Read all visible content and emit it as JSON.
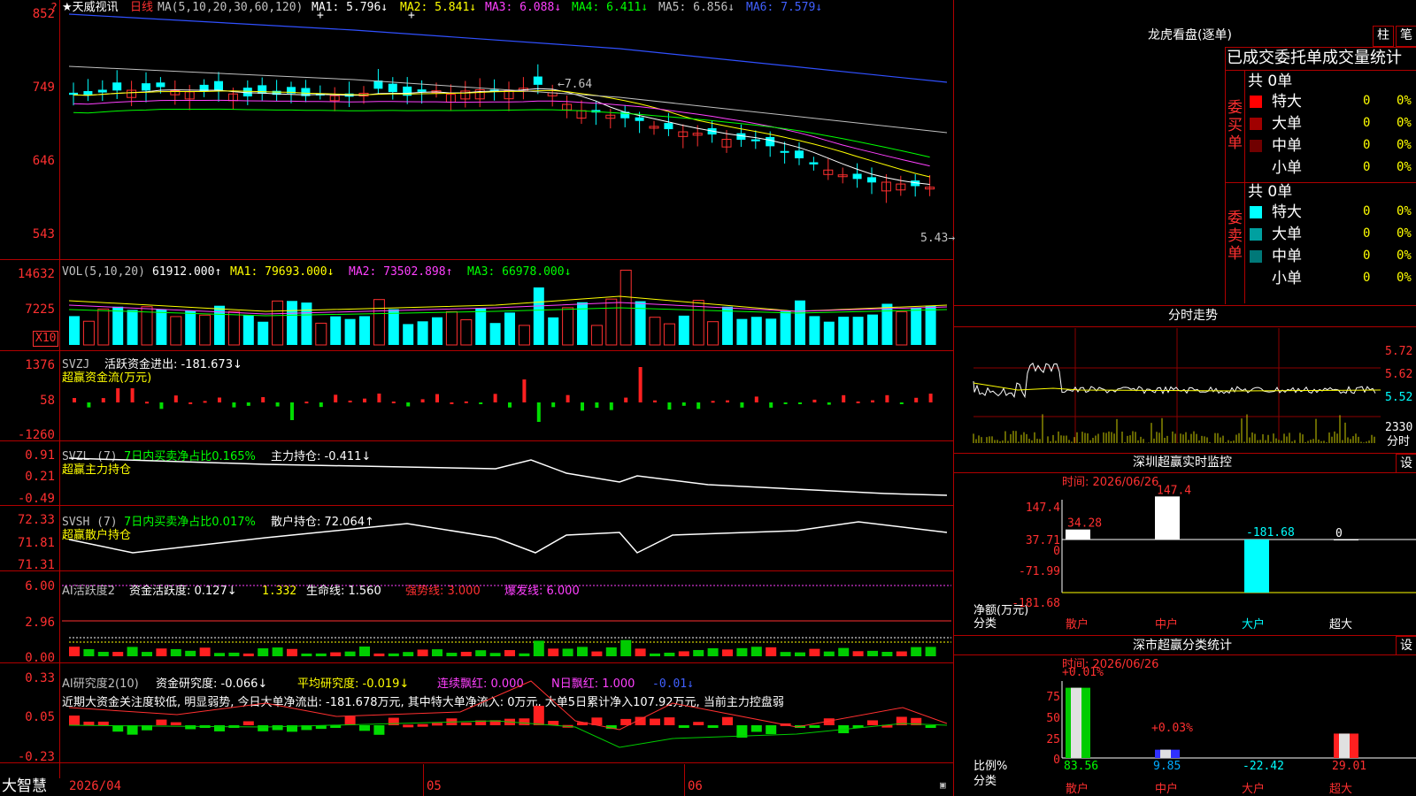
{
  "axes": {
    "main": [
      "852",
      "749",
      "646",
      "543"
    ],
    "vol": [
      "14632",
      "7225"
    ],
    "vol_unit": "X10",
    "svzj": [
      "1376",
      "58",
      "-1260"
    ],
    "svzl": [
      "0.91",
      "0.21",
      "-0.49"
    ],
    "svsh": [
      "72.33",
      "71.81",
      "71.31"
    ],
    "ai1": [
      "6.00",
      "2.96",
      "0.00"
    ],
    "ai2": [
      "0.33",
      "0.05",
      "-0.23"
    ]
  },
  "main": {
    "title": "★天威视讯",
    "period": "日线",
    "ma_prefix": "MA(5,10,20,30,60,120)",
    "ma1": "MA1: 5.796↓",
    "ma2": "MA2: 5.841↓",
    "ma3": "MA3: 6.088↓",
    "ma4": "MA4: 6.411↓",
    "ma5": "MA5: 6.856↓",
    "ma6": "MA6: 7.579↓",
    "high_label": "←7.64",
    "low_label": "5.43→"
  },
  "vol": {
    "prefix": "VOL(5,10,20)",
    "value": "61912.000↑",
    "ma1": "MA1: 79693.000↓",
    "ma2": "MA2: 73502.898↑",
    "ma3": "MA3: 66978.000↓"
  },
  "svzj": {
    "prefix": "SVZJ",
    "label": "活跃资金进出: -181.673↓",
    "sub": "超赢资金流(万元)"
  },
  "svzl": {
    "prefix": "SVZL (7)",
    "ratio": "7日内买卖净占比0.165%",
    "hold": "主力持仓: -0.411↓",
    "sub": "超赢主力持仓"
  },
  "svsh": {
    "prefix": "SVSH (7)",
    "ratio": "7日内买卖净占比0.017%",
    "hold": "散户持仓: 72.064↑",
    "sub": "超赢散户持仓"
  },
  "ai1": {
    "prefix": "AI活跃度2",
    "a": "资金活跃度: 0.127↓",
    "b": "1.332",
    "c": "生命线: 1.560",
    "d": "强势线: 3.000",
    "e": "爆发线: 6.000"
  },
  "ai2": {
    "prefix": "AI研究度2(10)",
    "a": "资金研究度: -0.066↓",
    "b": "平均研究度: -0.019↓",
    "c": "连续飘红: 0.000",
    "d": "N日飘红: 1.000",
    "e": "-0.01↓",
    "comment": "近期大资金关注度较低, 明显弱势, 今日大单净流出: -181.678万元, 其中特大单净流入: 0万元, 大单5日累计净入107.92万元, 当前主力控盘弱"
  },
  "bottom": {
    "logo": "大智慧",
    "date1": "2026/04",
    "date2": "05",
    "date3": "06"
  },
  "right": {
    "title": "龙虎看盘(逐单)",
    "btn_bar": "柱",
    "btn_pen": "笔",
    "tabs": "已成交委托单成交量统计",
    "buy_side": "委买单",
    "sell_side": "委卖单",
    "buy_total": "共 0单",
    "sell_total": "共 0单",
    "buy_rows": [
      {
        "label": "特大",
        "value": "0",
        "pct": "0%",
        "color": "#ff0000"
      },
      {
        "label": "大单",
        "value": "0",
        "pct": "0%",
        "color": "#a00000"
      },
      {
        "label": "中单",
        "value": "0",
        "pct": "0%",
        "color": "#700000"
      },
      {
        "label": "小单",
        "value": "0",
        "pct": "0%",
        "color": "#000000"
      }
    ],
    "sell_rows": [
      {
        "label": "特大",
        "value": "0",
        "pct": "0%",
        "color": "#00ffff"
      },
      {
        "label": "大单",
        "value": "0",
        "pct": "0%",
        "color": "#00a0a0"
      },
      {
        "label": "中单",
        "value": "0",
        "pct": "0%",
        "color": "#007878"
      },
      {
        "label": "小单",
        "value": "0",
        "pct": "0%",
        "color": "#000000"
      }
    ],
    "intraday": {
      "title": "分时走势",
      "prices": [
        "5.72",
        "5.62",
        "5.52"
      ],
      "vol": "2330",
      "vol_label": "分时"
    },
    "monitor": {
      "title": "深圳超赢实时监控",
      "set": "设",
      "time": "时间: 2026/06/26",
      "y": [
        "147.4",
        "37.71",
        "0",
        "-71.99",
        "-181.68"
      ],
      "ylabel": "净额(万元)",
      "xlabel": "分类",
      "cats": [
        "散户",
        "中户",
        "大户",
        "超大"
      ],
      "vals": [
        "34.28",
        "147.4",
        "-181.68",
        "0"
      ]
    },
    "stats": {
      "title": "深市超赢分类统计",
      "set": "设",
      "time": "时间: 2026/06/26",
      "y": [
        "75",
        "50",
        "25",
        "0"
      ],
      "ylabel": "比例%",
      "xlabel": "分类",
      "cats": [
        "散户",
        "中户",
        "大户",
        "超大"
      ],
      "top": [
        "+0.01%",
        "+0.03%"
      ],
      "vals": [
        "83.56",
        "9.85",
        "-22.42",
        "29.01"
      ]
    }
  }
}
